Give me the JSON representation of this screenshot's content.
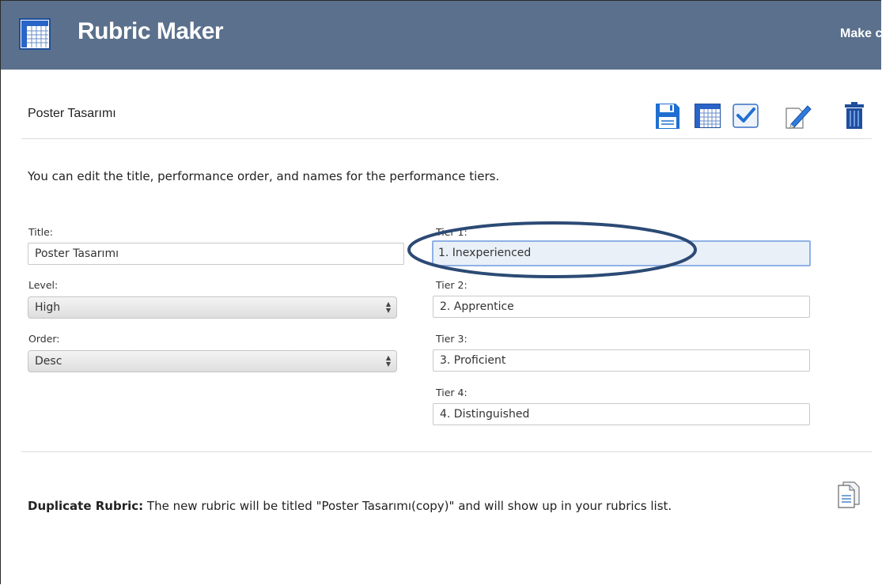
{
  "header": {
    "app_title": "Rubric Maker",
    "make_link": "Make c",
    "accent_color": "#5a708c"
  },
  "rubric": {
    "name": "Poster Tasarımı",
    "intro": "You can edit the title, performance order, and names for the performance tiers."
  },
  "toolbar": {
    "icons": [
      "save-icon",
      "table-icon",
      "checkmark-icon",
      "edit-pencil-icon",
      "trash-icon"
    ]
  },
  "form": {
    "title_label": "Title:",
    "title_value": "Poster Tasarımı",
    "level_label": "Level:",
    "level_value": "High",
    "order_label": "Order:",
    "order_value": "Desc",
    "tiers": [
      {
        "label": "Tier 1:",
        "value": "1. Inexperienced"
      },
      {
        "label": "Tier 2:",
        "value": "2. Apprentice"
      },
      {
        "label": "Tier 3:",
        "value": "3. Proficient"
      },
      {
        "label": "Tier 4:",
        "value": "4. Distinguished"
      }
    ]
  },
  "duplicate": {
    "label": "Duplicate Rubric:",
    "text": " The new rubric will be titled \"Poster Tasarımı(copy)\" and will show up in your rubrics list.",
    "icon": "duplicate-icon"
  },
  "annotation": {
    "color": "#2c4a75"
  }
}
